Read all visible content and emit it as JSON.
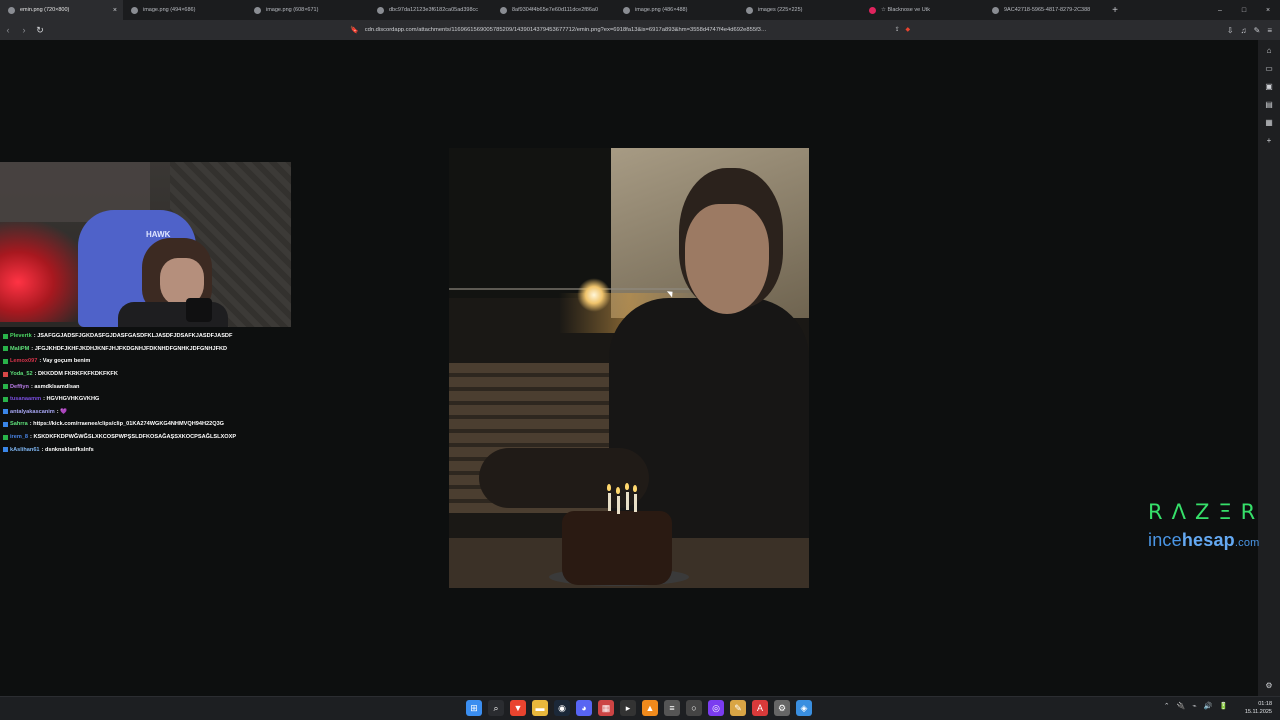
{
  "browser": {
    "tabs": [
      {
        "label": "emin.png (720×800)",
        "active": true,
        "close": "×"
      },
      {
        "label": "image.png (494×686)"
      },
      {
        "label": "image.png (608×671)"
      },
      {
        "label": "dbc97da12123e3f6182ca05ad398cc"
      },
      {
        "label": "8af9304f4b65e7e60d111dce2f86a0"
      },
      {
        "label": "image.png (486×488)"
      },
      {
        "label": "images (225×225)"
      },
      {
        "label": "☆ Blacknose ve Utk",
        "icon_color": "#e0245e"
      },
      {
        "label": "9AC42718-5965-4817-8279-2C388"
      }
    ],
    "new_tab": "+",
    "window_controls": [
      "–",
      "□",
      "×"
    ],
    "nav": {
      "back": "‹",
      "forward": "›",
      "reload": "↻",
      "bookmark": "🔖"
    },
    "url": "cdn.discordapp.com/attachments/1169661569005785209/1439014379453677712/emin.png?ex=6918fa13&is=6917a893&hm=3558d4747f4e4d692e855f3…",
    "toolbar_right": [
      "⇩",
      "♫",
      "✎",
      "≡"
    ]
  },
  "sidebar_icons": [
    "⌂",
    "▭",
    "▣",
    "▤",
    "▦",
    "+",
    "⚙"
  ],
  "chat": [
    {
      "user": "Plevertk",
      "color": "#4cd964",
      "badge": "#29b34a",
      "msg": ": JSAFGGJADSFJGKDASFGJDASFGASDFKLJASDFJDSAFKJASDFJASDF"
    },
    {
      "user": "MaliPM",
      "color": "#5fe07a",
      "badge": "#29b34a",
      "msg": ": JFGJKHDFJKHFJKDHJKNFJHJFKDGNHJFDKNHDFGNHKJDFGNHJFKD"
    },
    {
      "user": "Lemox097",
      "color": "#d6334a",
      "badge": "#29b34a",
      "msg": ": Vay goçum benim"
    },
    {
      "user": "Yoda_52",
      "color": "#5fe07a",
      "badge": "#d84848",
      "msg": ": DKKDDM FKRKFKFKDKFKFK"
    },
    {
      "user": "Deffiyn",
      "color": "#b97de8",
      "badge": "#29b34a",
      "msg": ": asmdklsamdlsan"
    },
    {
      "user": "tusanaamm",
      "color": "#7a4ee0",
      "badge": "#29b34a",
      "msg": ": HGVHGVHKGVKHG"
    },
    {
      "user": "antalyakascanim",
      "color": "#a7a6f3",
      "badge": "#3a86e8",
      "msg": ": 💜"
    },
    {
      "user": "Sahrra",
      "color": "#5fe07a",
      "badge": "#3a86e8",
      "msg": ": https://kick.com/rraenee/clips/clip_01KA274WGKG4NHMVQH94H22Q3G"
    },
    {
      "user": "irem_8",
      "color": "#4a86e8",
      "badge": "#29b34a",
      "msg": ": KSKDKFKDPWĞWĞSLXKCOSPWPŞSLDFKOSAĞAŞSXKOCPSAĞLSLXOXP"
    },
    {
      "user": "kAslihan61",
      "color": "#7fb6f2",
      "badge": "#3a86e8",
      "msg": ": dsnknsklsnfkslnfs"
    }
  ],
  "webcam": {
    "chair_text": "HAWK"
  },
  "brand": {
    "razer": "RΛZΞR",
    "site_pre": "ince",
    "site_bold": "hesap",
    "site_post": ".com"
  },
  "taskbar": {
    "icons": [
      {
        "name": "windows-start-icon",
        "glyph": "⊞",
        "color": "#3b8ef0"
      },
      {
        "name": "search-icon",
        "glyph": "⌕",
        "color": "#2a2c30"
      },
      {
        "name": "brave-icon",
        "glyph": "▼",
        "color": "#e9442f"
      },
      {
        "name": "folder-icon",
        "glyph": "▬",
        "color": "#e8b83c"
      },
      {
        "name": "steam-icon",
        "glyph": "◉",
        "color": "#1b2838"
      },
      {
        "name": "discord-icon",
        "glyph": "◕",
        "color": "#5865f2"
      },
      {
        "name": "calendar-icon",
        "glyph": "▦",
        "color": "#c44"
      },
      {
        "name": "terminal-icon",
        "glyph": "▸",
        "color": "#333"
      },
      {
        "name": "vlc-icon",
        "glyph": "▲",
        "color": "#f08a1c"
      },
      {
        "name": "settings-app-icon",
        "glyph": "≡",
        "color": "#555"
      },
      {
        "name": "app-circle-icon",
        "glyph": "○",
        "color": "#444"
      },
      {
        "name": "obs-icon",
        "glyph": "◎",
        "color": "#7b3cf0"
      },
      {
        "name": "pen-icon",
        "glyph": "✎",
        "color": "#d9a545"
      },
      {
        "name": "adobe-icon",
        "glyph": "A",
        "color": "#d83a3a"
      },
      {
        "name": "gear-icon",
        "glyph": "⚙",
        "color": "#666"
      },
      {
        "name": "network-app-icon",
        "glyph": "◈",
        "color": "#3a8fe0"
      }
    ],
    "tray": [
      "⌃",
      "🔌",
      "⌁",
      "🔊",
      "🔋"
    ],
    "time": "01:18",
    "date": "15.11.2025"
  }
}
